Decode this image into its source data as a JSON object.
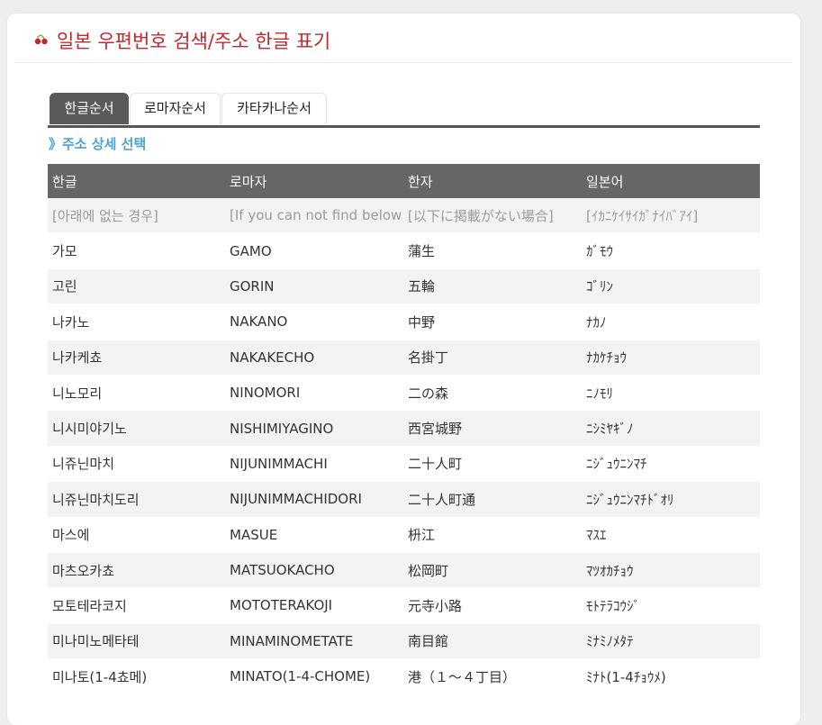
{
  "header": {
    "title": "일본 우편번호 검색/주소 한글 표기",
    "logo_icon": "cherry-icon",
    "title_color": "#c0282d"
  },
  "tabs": [
    {
      "label": "한글순서",
      "active": true
    },
    {
      "label": "로마자순서",
      "active": false
    },
    {
      "label": "카타카나순서",
      "active": false
    }
  ],
  "section": {
    "title": "》주소 상세 선택",
    "color": "#4aa3d8"
  },
  "table": {
    "columns": [
      "한글",
      "로마자",
      "한자",
      "일본어"
    ],
    "rows": [
      [
        "[아래에 없는 경우]",
        "[If you can not find below]",
        "[以下に掲載がない場合]",
        "[ｲｶﾆｹｲｻｲｶﾞﾅｲﾊﾞｱｲ]"
      ],
      [
        "가모",
        "GAMO",
        "蒲生",
        "ｶﾞﾓｳ"
      ],
      [
        "고린",
        "GORIN",
        "五輪",
        "ｺﾞﾘﾝ"
      ],
      [
        "나카노",
        "NAKANO",
        "中野",
        "ﾅｶﾉ"
      ],
      [
        "나카케쵸",
        "NAKAKECHO",
        "名掛丁",
        "ﾅｶｹﾁｮｳ"
      ],
      [
        "니노모리",
        "NINOMORI",
        "二の森",
        "ﾆﾉﾓﾘ"
      ],
      [
        "니시미야기노",
        "NISHIMIYAGINO",
        "西宮城野",
        "ﾆｼﾐﾔｷﾞﾉ"
      ],
      [
        "니쥬닌마치",
        "NIJUNIMMACHI",
        "二十人町",
        "ﾆｼﾞｭｳﾆﾝﾏﾁ"
      ],
      [
        "니쥬닌마치도리",
        "NIJUNIMMACHIDORI",
        "二十人町通",
        "ﾆｼﾞｭｳﾆﾝﾏﾁﾄﾞｵﾘ"
      ],
      [
        "마스에",
        "MASUE",
        "枡江",
        "ﾏｽｴ"
      ],
      [
        "마츠오카쵸",
        "MATSUOKACHO",
        "松岡町",
        "ﾏﾂｵｶﾁｮｳ"
      ],
      [
        "모토테라코지",
        "MOTOTERAKOJI",
        "元寺小路",
        "ﾓﾄﾃﾗｺｳｼﾞ"
      ],
      [
        "미나미노메타테",
        "MINAMINOMETATE",
        "南目館",
        "ﾐﾅﾐﾉﾒﾀﾃ"
      ],
      [
        "미나토(1-4쵸메)",
        "MINATO(1-4-CHOME)",
        "港（１～４丁目）",
        "ﾐﾅﾄ(1-4ﾁｮｳﾒ)"
      ]
    ]
  }
}
